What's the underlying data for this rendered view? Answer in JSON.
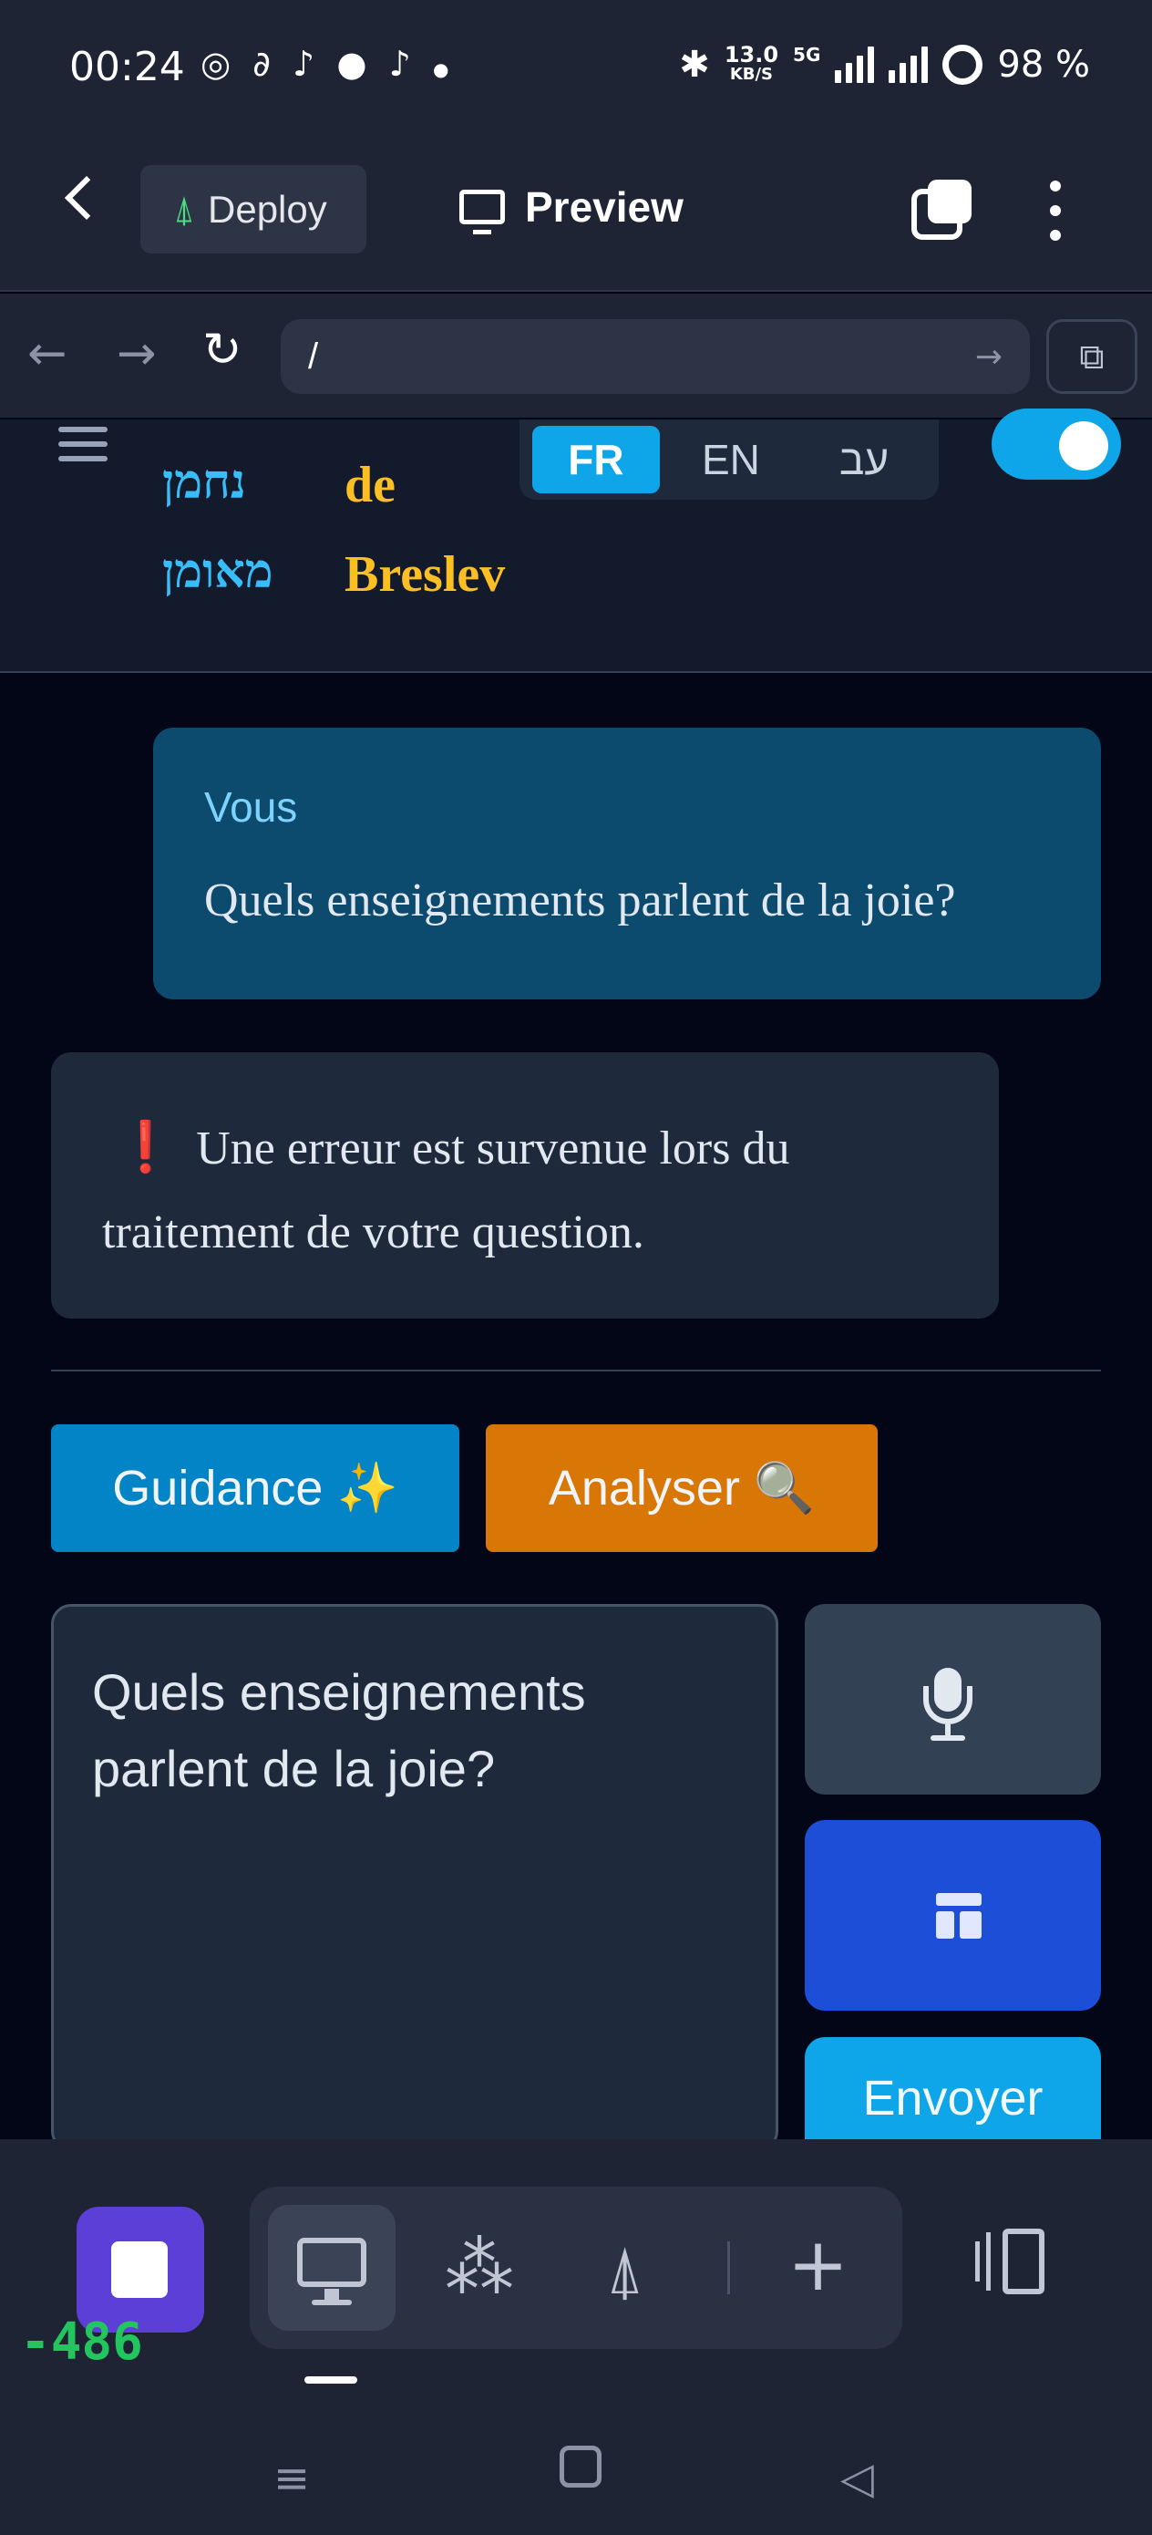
{
  "status_bar": {
    "time": "00:24",
    "notification_icons": [
      "whatsapp-icon",
      "link-icon",
      "tiktok-icon",
      "location-icon",
      "tiktok-icon",
      "dot-icon"
    ],
    "net_speed_value": "13.0",
    "net_speed_unit": "KB/S",
    "network": "5G",
    "battery": "98 %"
  },
  "app_bar": {
    "deploy_label": "Deploy",
    "preview_label": "Preview"
  },
  "url_bar": {
    "url": "/"
  },
  "site_header": {
    "hebrew_line1": "נחמן",
    "hebrew_line2": "מאומן",
    "title_line1": "de",
    "title_line2": "Breslev",
    "languages": [
      {
        "code": "FR",
        "active": true
      },
      {
        "code": "EN",
        "active": false
      },
      {
        "code": "עב",
        "active": false
      }
    ]
  },
  "chat": {
    "user_label": "Vous",
    "user_message": "Quels enseignements parlent de la joie?",
    "error_icon": "❗",
    "error_message": "Une erreur est survenue lors du traitement de votre question."
  },
  "actions": {
    "guidance_label": "Guidance ✨",
    "analyze_label": "Analyser 🔍"
  },
  "composer": {
    "input_value": "Quels enseignements parlent de la joie?",
    "send_label": "Envoyer"
  },
  "bottom_toolbar": {
    "counter": "-486"
  },
  "colors": {
    "accent": "#0ea5e9",
    "gold": "#fbbf24",
    "orange": "#d97706",
    "page_bg": "#020617"
  }
}
